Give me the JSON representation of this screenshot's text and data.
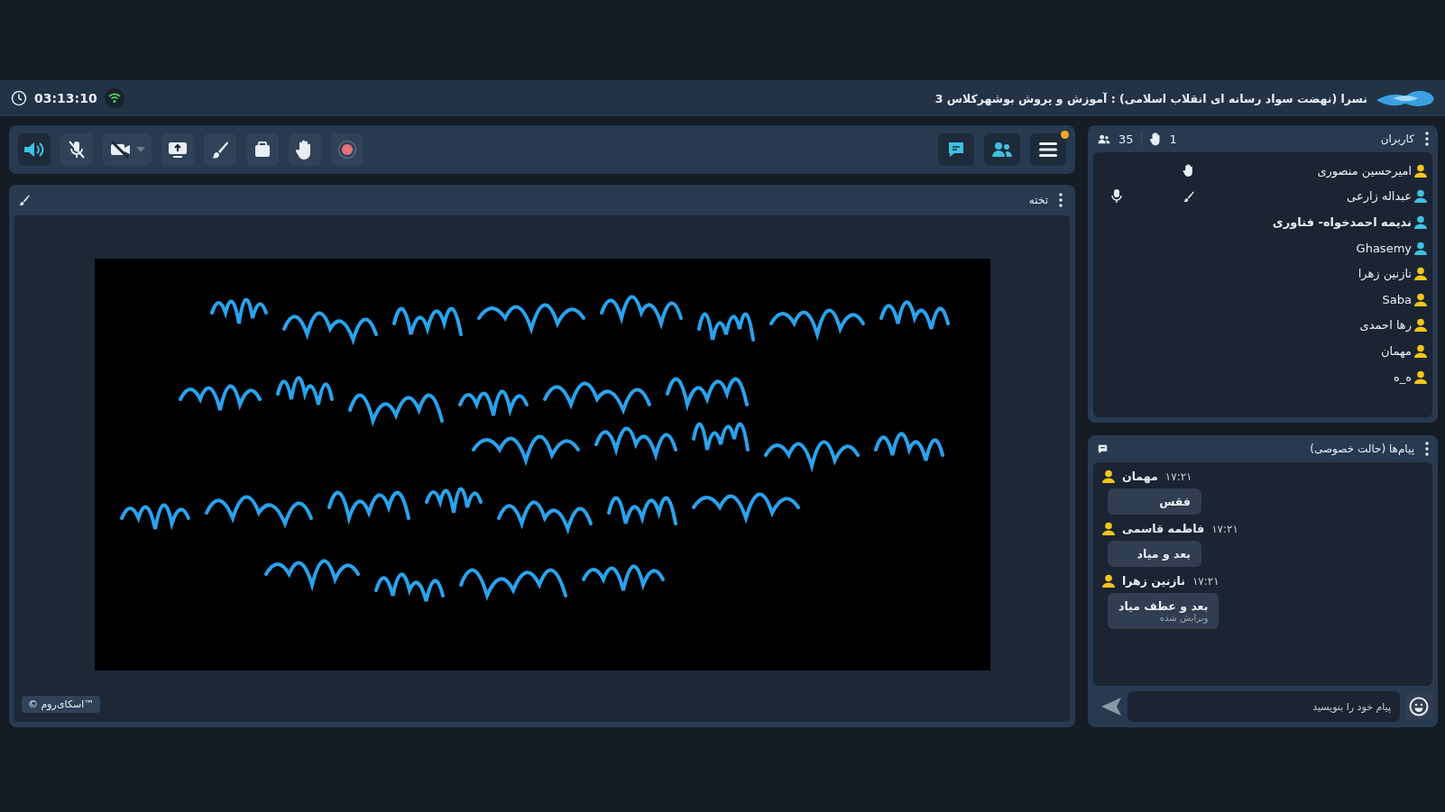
{
  "header": {
    "time": "03:13:10",
    "title": "نسرا (نهضت سواد رسانه ای انقلاب اسلامی) : آموزش و پروش بوشهرکلاس 3"
  },
  "toolbar": [
    {
      "kind": "speaker",
      "active": true
    },
    {
      "kind": "mic",
      "active": false
    },
    {
      "kind": "camera",
      "active": false
    },
    {
      "kind": "share",
      "active": false
    },
    {
      "kind": "brush",
      "active": false
    },
    {
      "kind": "files",
      "active": false
    },
    {
      "kind": "hand",
      "active": false
    },
    {
      "kind": "record",
      "active": false
    }
  ],
  "toolbar_right": [
    {
      "kind": "chat",
      "active": true
    },
    {
      "kind": "users",
      "active": true
    },
    {
      "kind": "menu",
      "active": false,
      "notification": true
    }
  ],
  "board": {
    "title": "تخته",
    "brand": "© اسکای‌روم™"
  },
  "users_panel": {
    "title": "کاربران",
    "count": "35",
    "hands": "1",
    "users": [
      {
        "name": "امیرحسین منصوری",
        "color": "#f5c518",
        "bold": false,
        "hand_raised": true,
        "can_draw": false,
        "mic": false
      },
      {
        "name": "عبداله زارعی",
        "color": "#3fc1e0",
        "bold": false,
        "hand_raised": false,
        "can_draw": true,
        "mic": true
      },
      {
        "name": "ندیمه احمدخواه- فناوری",
        "color": "#3fc1e0",
        "bold": true,
        "hand_raised": false,
        "can_draw": false,
        "mic": false
      },
      {
        "name": "Ghasemy",
        "color": "#3fc1e0",
        "bold": false,
        "hand_raised": false,
        "can_draw": false,
        "mic": false
      },
      {
        "name": "نازنین زهرا",
        "color": "#f5c518",
        "bold": false,
        "hand_raised": false,
        "can_draw": false,
        "mic": false
      },
      {
        "name": "Saba",
        "color": "#f5c518",
        "bold": false,
        "hand_raised": false,
        "can_draw": false,
        "mic": false
      },
      {
        "name": "رها احمدی",
        "color": "#f5c518",
        "bold": false,
        "hand_raised": false,
        "can_draw": false,
        "mic": false
      },
      {
        "name": "مهمان",
        "color": "#f5c518",
        "bold": false,
        "hand_raised": false,
        "can_draw": false,
        "mic": false
      },
      {
        "name": "ه_ه",
        "color": "#f5c518",
        "bold": false,
        "hand_raised": false,
        "can_draw": false,
        "mic": false
      }
    ]
  },
  "messages_panel": {
    "title": "پیام‌ها (حالت خصوصی)",
    "placeholder": "پیام خود را بنویسید",
    "messages": [
      {
        "sender": "مهمان",
        "time": "۱۷:۲۱",
        "text": "فقس"
      },
      {
        "sender": "فاطمه قاسمی",
        "time": "۱۷:۲۱",
        "text": "بعد و میاد"
      },
      {
        "sender": "نازنین زهرا",
        "time": "۱۷:۲۱",
        "text": "بعد و عطف میاد",
        "note": "ویرایش شده"
      }
    ]
  }
}
